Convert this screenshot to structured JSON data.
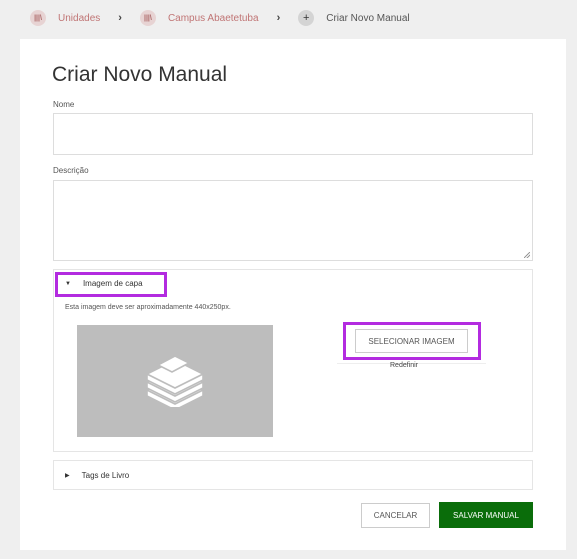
{
  "breadcrumb": [
    {
      "label": "Unidades",
      "icon": "book-icon"
    },
    {
      "label": "Campus Abaetetuba",
      "icon": "book-icon"
    },
    {
      "label": "Criar Novo Manual",
      "icon": "plus-icon"
    }
  ],
  "form": {
    "title": "Criar Novo Manual",
    "name_label": "Nome",
    "name_value": "",
    "description_label": "Descrição",
    "description_value": ""
  },
  "cover": {
    "toggle_label": "Imagem de capa",
    "hint": "Esta imagem deve ser aproximadamente 440x250px.",
    "select_button": "SELECIONAR IMAGEM",
    "reset_link": "Redefinir"
  },
  "tags": {
    "toggle_label": "Tags de Livro"
  },
  "actions": {
    "cancel": "CANCELAR",
    "save": "SALVAR MANUAL"
  },
  "colors": {
    "highlight": "#b32be0",
    "save_button": "#0a6d0a",
    "breadcrumb_link": "#c07575"
  }
}
